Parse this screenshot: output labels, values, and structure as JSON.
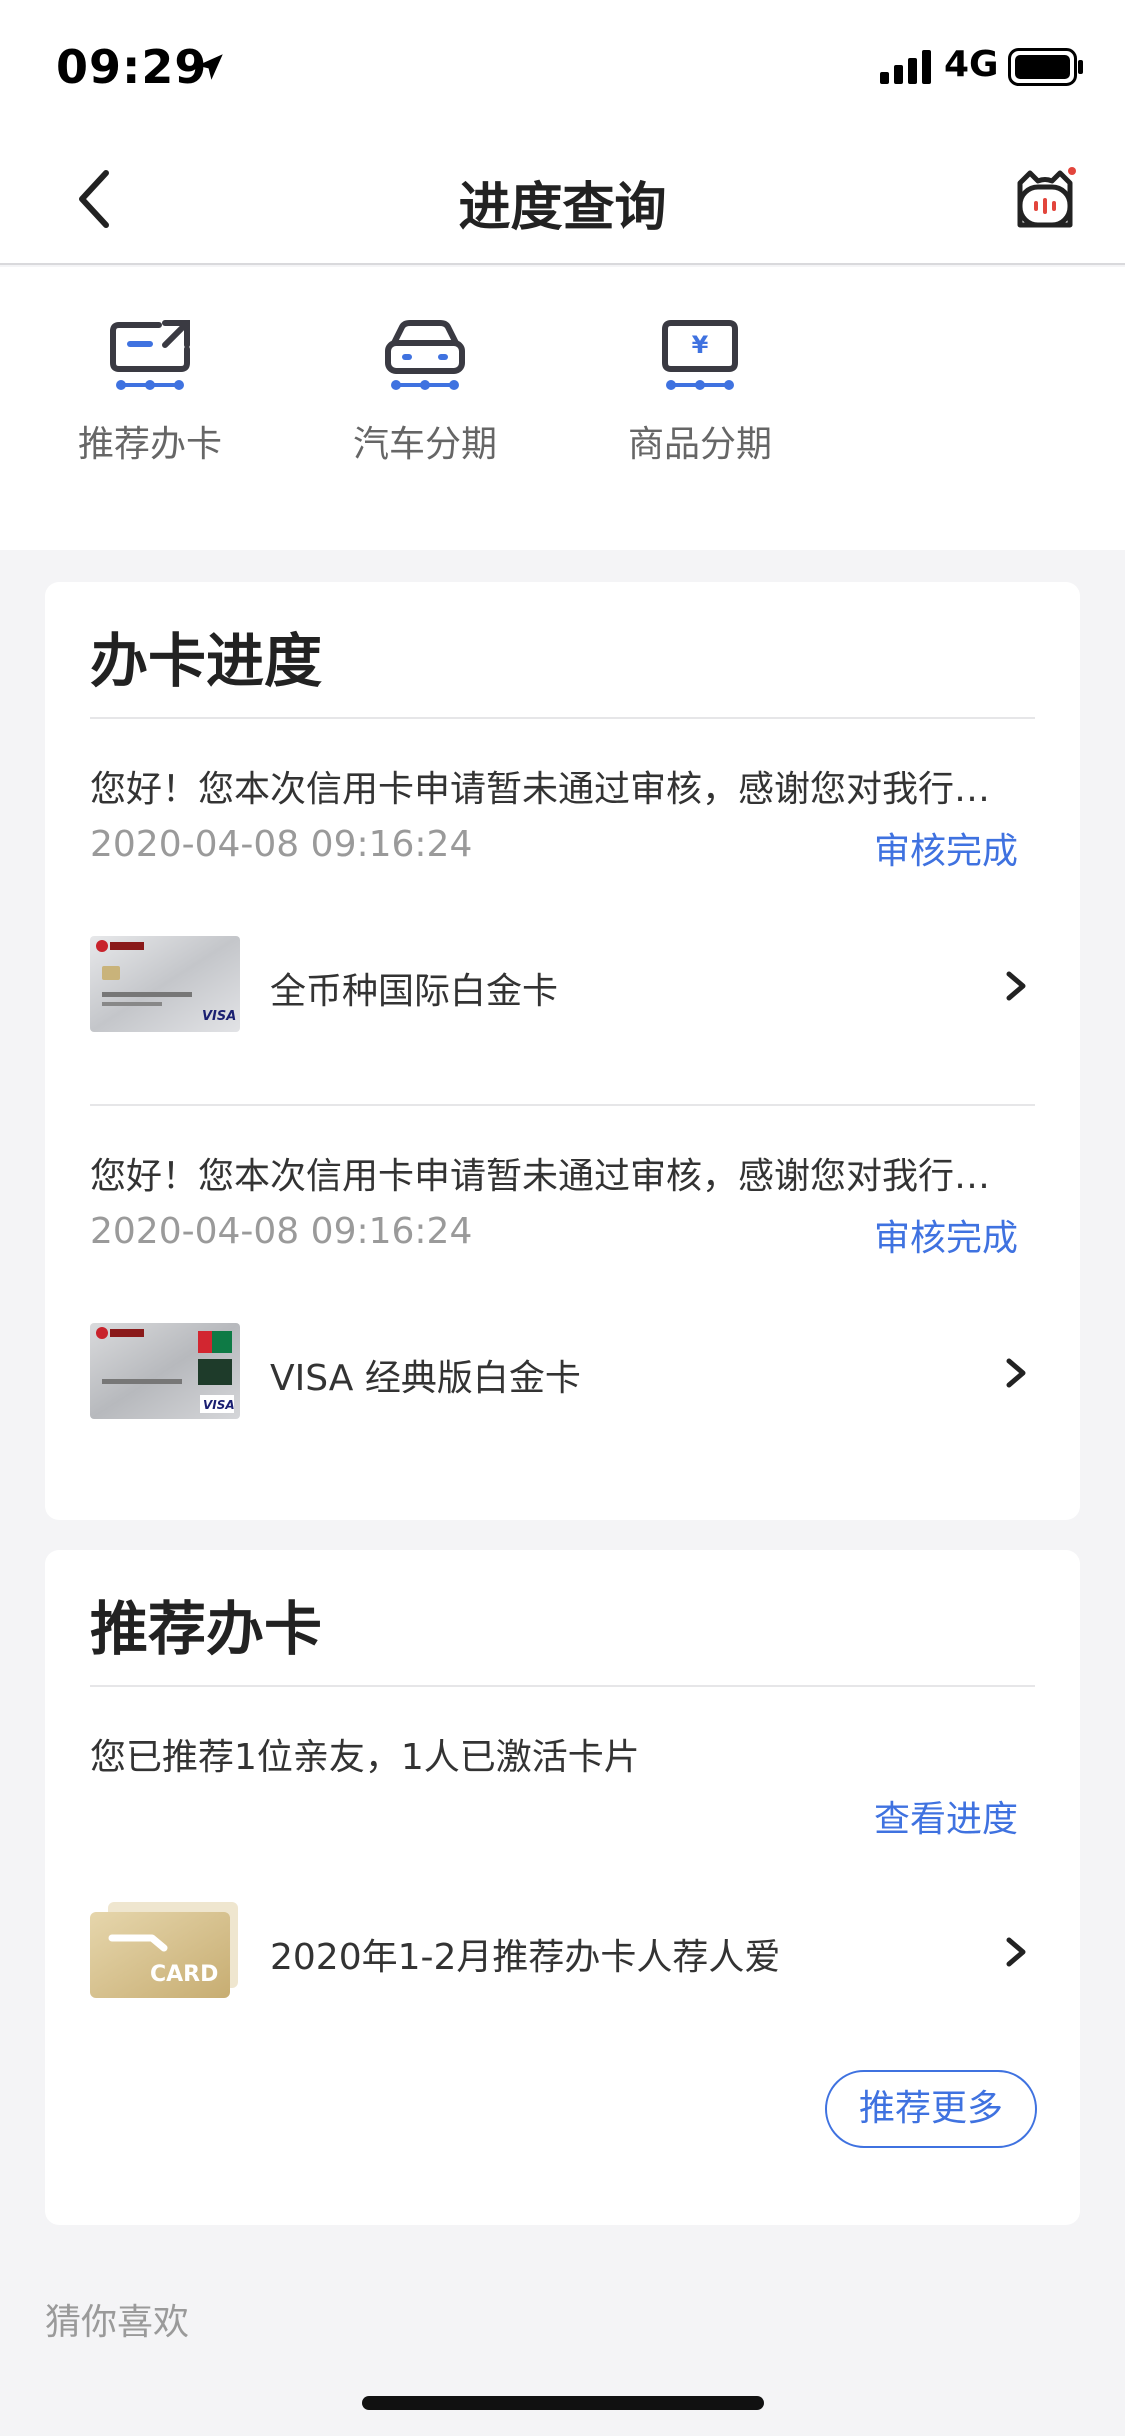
{
  "status_bar": {
    "time": "09:29",
    "network": "4G"
  },
  "nav": {
    "title": "进度查询"
  },
  "categories": [
    {
      "label": "推荐办卡",
      "icon": "card-share-icon"
    },
    {
      "label": "汽车分期",
      "icon": "car-icon"
    },
    {
      "label": "商品分期",
      "icon": "yen-tag-icon"
    }
  ],
  "progress_panel": {
    "title": "办卡进度",
    "items": [
      {
        "message": "您好！您本次信用卡申请暂未通过审核，感谢您对我行…",
        "datetime": "2020-04-08 09:16:24",
        "status": "审核完成",
        "card_name": "全币种国际白金卡"
      },
      {
        "message": "您好！您本次信用卡申请暂未通过审核，感谢您对我行…",
        "datetime": "2020-04-08 09:16:24",
        "status": "审核完成",
        "card_name": "VISA 经典版白金卡"
      }
    ]
  },
  "recommend_panel": {
    "title": "推荐办卡",
    "summary": "您已推荐1位亲友，1人已激活卡片",
    "view_progress": "查看进度",
    "campaign": "2020年1-2月推荐办卡人荐人爱",
    "card_badge": "CARD",
    "more_button": "推荐更多"
  },
  "footer": {
    "guess_like": "猜你喜欢"
  },
  "colors": {
    "accent": "#3f72e0",
    "background": "#f4f4f6"
  }
}
